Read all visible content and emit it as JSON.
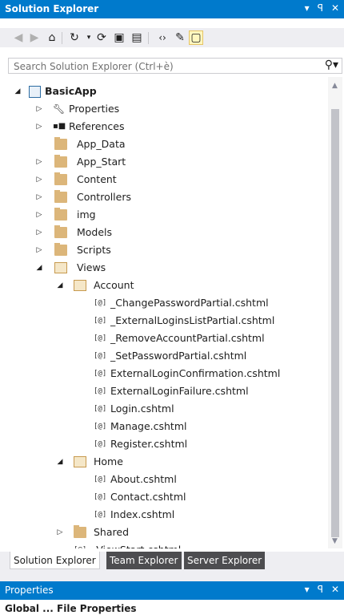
{
  "window": {
    "title": "Solution Explorer",
    "buttons": [
      "▾",
      "ꟼ",
      "✕"
    ]
  },
  "toolbar": {
    "icons": [
      "back-icon",
      "forward-icon",
      "home-icon",
      "history-icon",
      "sync-icon",
      "collapse-all-icon",
      "show-all-files-icon",
      "view-code-icon",
      "properties-icon",
      "preview-icon"
    ]
  },
  "search": {
    "placeholder": "Search Solution Explorer (Ctrl+è)",
    "icon": "⚲▾"
  },
  "tree": {
    "root": "BasicApp",
    "properties": "Properties",
    "references": "References",
    "app_data": "App_Data",
    "app_start": "App_Start",
    "content": "Content",
    "controllers": "Controllers",
    "img": "img",
    "models": "Models",
    "scripts": "Scripts",
    "views": "Views",
    "account": "Account",
    "account_files": [
      "_ChangePasswordPartial.cshtml",
      "_ExternalLoginsListPartial.cshtml",
      "_RemoveAccountPartial.cshtml",
      "_SetPasswordPartial.cshtml",
      "ExternalLoginConfirmation.cshtml",
      "ExternalLoginFailure.cshtml",
      "Login.cshtml",
      "Manage.cshtml",
      "Register.cshtml"
    ],
    "home": "Home",
    "home_files": [
      "About.cshtml",
      "Contact.cshtml",
      "Index.cshtml"
    ],
    "shared": "Shared",
    "viewstart": "_ViewStart.cshtml",
    "cshtml_glyph": "[@]"
  },
  "tabs": {
    "solution_explorer": "Solution Explorer",
    "team_explorer": "Team Explorer",
    "server_explorer": "Server Explorer"
  },
  "properties_panel": {
    "title": "Properties",
    "buttons": [
      "▾",
      "ꟼ",
      "✕"
    ],
    "partial_text": "Global ... File Properties"
  }
}
